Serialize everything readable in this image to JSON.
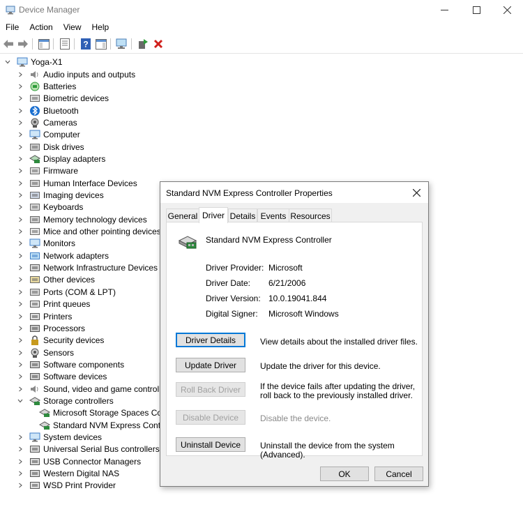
{
  "window": {
    "title": "Device Manager",
    "minimize_glyph": "—",
    "maximize_glyph": "☐",
    "close_glyph": "✕"
  },
  "menu": [
    "File",
    "Action",
    "View",
    "Help"
  ],
  "toolbar": {
    "icons": [
      "back-arrow-icon",
      "forward-arrow-icon",
      "show-hide-tree-icon",
      "properties-icon",
      "help-icon",
      "action-pane-icon",
      "monitor-scan-icon",
      "add-driver-icon",
      "uninstall-x-icon"
    ]
  },
  "tree": {
    "root": "Yoga-X1",
    "items": [
      {
        "label": "Audio inputs and outputs",
        "icon": "speaker-icon"
      },
      {
        "label": "Batteries",
        "icon": "battery-icon"
      },
      {
        "label": "Biometric devices",
        "icon": "fingerprint-icon"
      },
      {
        "label": "Bluetooth",
        "icon": "bluetooth-icon"
      },
      {
        "label": "Cameras",
        "icon": "camera-icon"
      },
      {
        "label": "Computer",
        "icon": "computer-icon"
      },
      {
        "label": "Disk drives",
        "icon": "disk-icon"
      },
      {
        "label": "Display adapters",
        "icon": "display-adapter-icon"
      },
      {
        "label": "Firmware",
        "icon": "firmware-icon"
      },
      {
        "label": "Human Interface Devices",
        "icon": "hid-icon"
      },
      {
        "label": "Imaging devices",
        "icon": "imaging-icon"
      },
      {
        "label": "Keyboards",
        "icon": "keyboard-icon"
      },
      {
        "label": "Memory technology devices",
        "icon": "memory-icon"
      },
      {
        "label": "Mice and other pointing devices",
        "icon": "mouse-icon"
      },
      {
        "label": "Monitors",
        "icon": "monitor-icon"
      },
      {
        "label": "Network adapters",
        "icon": "network-adapter-icon"
      },
      {
        "label": "Network Infrastructure Devices",
        "icon": "network-infra-icon"
      },
      {
        "label": "Other devices",
        "icon": "other-devices-icon"
      },
      {
        "label": "Ports (COM & LPT)",
        "icon": "port-icon"
      },
      {
        "label": "Print queues",
        "icon": "print-queue-icon"
      },
      {
        "label": "Printers",
        "icon": "printer-icon"
      },
      {
        "label": "Processors",
        "icon": "processor-icon"
      },
      {
        "label": "Security devices",
        "icon": "security-icon"
      },
      {
        "label": "Sensors",
        "icon": "sensor-icon"
      },
      {
        "label": "Software components",
        "icon": "software-component-icon"
      },
      {
        "label": "Software devices",
        "icon": "software-device-icon"
      },
      {
        "label": "Sound, video and game controllers",
        "icon": "sound-icon"
      },
      {
        "label": "Storage controllers",
        "icon": "storage-controller-icon",
        "expanded": true
      },
      {
        "label": "Microsoft Storage Spaces Controller",
        "icon": "storage-controller-icon",
        "child": true
      },
      {
        "label": "Standard NVM Express Controller",
        "icon": "storage-controller-icon",
        "child": true
      },
      {
        "label": "System devices",
        "icon": "system-device-icon"
      },
      {
        "label": "Universal Serial Bus controllers",
        "icon": "usb-icon"
      },
      {
        "label": "USB Connector Managers",
        "icon": "usb-connector-icon"
      },
      {
        "label": "Western Digital NAS",
        "icon": "nas-icon"
      },
      {
        "label": "WSD Print Provider",
        "icon": "wsd-icon"
      }
    ]
  },
  "dialog": {
    "title": "Standard NVM Express Controller Properties",
    "close_glyph": "✕",
    "tabs": [
      "General",
      "Driver",
      "Details",
      "Events",
      "Resources"
    ],
    "active_tab": "Driver",
    "device_name": "Standard NVM Express Controller",
    "props": [
      {
        "label": "Driver Provider:",
        "value": "Microsoft"
      },
      {
        "label": "Driver Date:",
        "value": "6/21/2006"
      },
      {
        "label": "Driver Version:",
        "value": "10.0.19041.844"
      },
      {
        "label": "Digital Signer:",
        "value": "Microsoft Windows"
      }
    ],
    "actions": [
      {
        "button": "Driver Details",
        "desc": "View details about the installed driver files.",
        "enabled": true,
        "focused": true
      },
      {
        "button": "Update Driver",
        "desc": "Update the driver for this device.",
        "enabled": true
      },
      {
        "button": "Roll Back Driver",
        "desc": "If the device fails after updating the driver, roll back to the previously installed driver.",
        "enabled": false
      },
      {
        "button": "Disable Device",
        "desc": "Disable the device.",
        "enabled": false
      },
      {
        "button": "Uninstall Device",
        "desc": "Uninstall the device from the system (Advanced).",
        "enabled": true
      }
    ],
    "ok_label": "OK",
    "cancel_label": "Cancel"
  },
  "colors": {
    "accent": "#0078d7",
    "disabled_text": "#a0a0a0",
    "dialog_bg": "#f0f0f0"
  }
}
